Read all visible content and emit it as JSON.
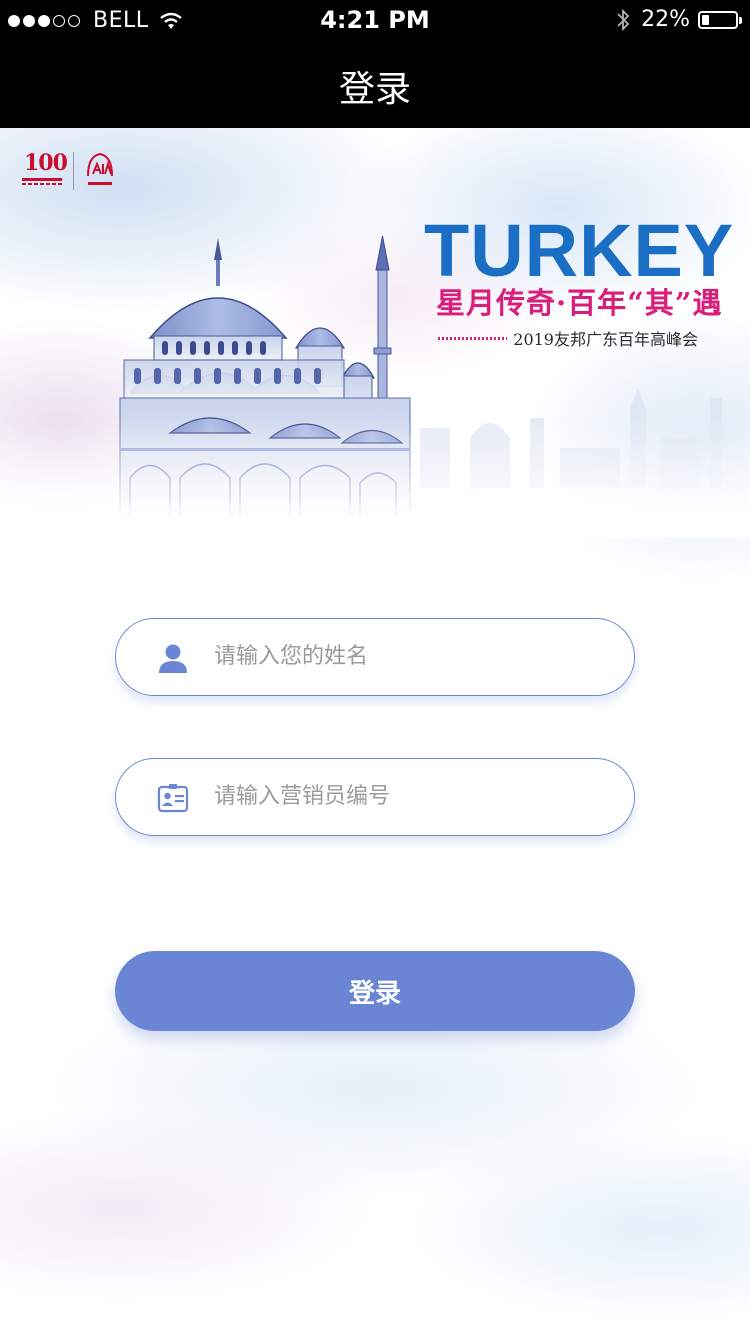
{
  "status_bar": {
    "carrier": "BELL",
    "time": "4:21 PM",
    "battery_percent": "22%",
    "battery_level": 0.22,
    "signal_bars_filled": 3,
    "signal_bars_total": 5,
    "icons": [
      "wifi-icon",
      "bluetooth-icon",
      "battery-icon"
    ]
  },
  "nav": {
    "title": "登录"
  },
  "banner": {
    "logo_100_number": "100",
    "turkey_title": "TURKEY",
    "turkey_subtitle": "星月传奇·百年“其”遇",
    "event_line": "2019友邦广东百年高峰会",
    "colors": {
      "title_blue": "#1a6fc4",
      "subtitle_pink": "#d81d7a",
      "logo_red": "#c8102e"
    }
  },
  "form": {
    "name_placeholder": "请输入您的姓名",
    "name_value": "",
    "code_placeholder": "请输入营销员编号",
    "code_value": "",
    "submit_label": "登录",
    "colors": {
      "accent": "#6b85d5",
      "border": "#6e87d4"
    }
  }
}
